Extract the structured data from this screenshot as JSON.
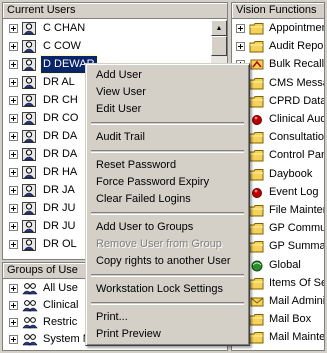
{
  "current_users": {
    "header": "Current Users",
    "rows": [
      {
        "label": "C CHAN"
      },
      {
        "label": "C COW"
      },
      {
        "label": "D DEWAR"
      },
      {
        "label": "DR AL"
      },
      {
        "label": "DR CH"
      },
      {
        "label": "DR CO"
      },
      {
        "label": "DR DA"
      },
      {
        "label": "DR DA"
      },
      {
        "label": "DR HA"
      },
      {
        "label": "DR JA"
      },
      {
        "label": "DR JU"
      },
      {
        "label": "DR JU"
      },
      {
        "label": "DR OL"
      }
    ]
  },
  "groups": {
    "header": "Groups of Use",
    "rows": [
      {
        "label": "All Use"
      },
      {
        "label": "Clinical"
      },
      {
        "label": "Restric"
      },
      {
        "label": "System Managers"
      }
    ]
  },
  "vision_functions": {
    "header": "Vision Functions",
    "rows": [
      {
        "label": "Appointmen",
        "icon": "folder"
      },
      {
        "label": "Audit Repo",
        "icon": "folder"
      },
      {
        "label": "Bulk Recalls",
        "icon": "recall"
      },
      {
        "label": "CMS Messa",
        "icon": "folder"
      },
      {
        "label": "CPRD Data",
        "icon": "folder"
      },
      {
        "label": "Clinical Aud",
        "icon": "red"
      },
      {
        "label": "Consultation",
        "icon": "folder"
      },
      {
        "label": "Control Pan",
        "icon": "folder"
      },
      {
        "label": "Daybook",
        "icon": "folder"
      },
      {
        "label": "Event Log",
        "icon": "red"
      },
      {
        "label": "File Mainter",
        "icon": "folder"
      },
      {
        "label": "GP Commun",
        "icon": "folder"
      },
      {
        "label": "GP Summar",
        "icon": "folder"
      },
      {
        "label": "Global",
        "icon": "green"
      },
      {
        "label": "Items Of Se",
        "icon": "folder"
      },
      {
        "label": "Mail Adminis",
        "icon": "mail"
      },
      {
        "label": "Mail Box",
        "icon": "folder"
      },
      {
        "label": "Mail Mainte",
        "icon": "folder"
      }
    ]
  },
  "context_menu": {
    "items": [
      {
        "label": "Add User"
      },
      {
        "label": "View User"
      },
      {
        "label": "Edit User"
      },
      {
        "sep": true
      },
      {
        "label": "Audit Trail"
      },
      {
        "sep": true
      },
      {
        "label": "Reset Password"
      },
      {
        "label": "Force Password Expiry"
      },
      {
        "label": "Clear Failed Logins"
      },
      {
        "sep": true
      },
      {
        "label": "Add User to Groups"
      },
      {
        "label": "Remove User from Group",
        "disabled": true
      },
      {
        "label": "Copy rights to another User"
      },
      {
        "sep": true
      },
      {
        "label": "Workstation Lock Settings"
      },
      {
        "sep": true
      },
      {
        "label": "Print..."
      },
      {
        "label": "Print Preview"
      }
    ]
  },
  "colors": {
    "selection": "#0a246a",
    "window_face": "#d4d0c8",
    "folder": "#f5d25a"
  }
}
